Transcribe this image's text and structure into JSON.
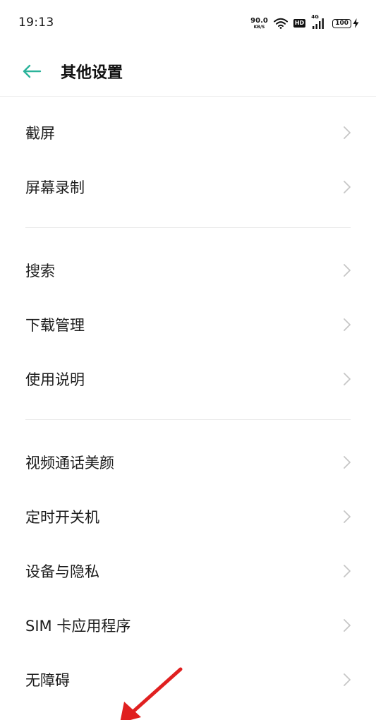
{
  "status_bar": {
    "time": "19:13",
    "net_speed_value": "90.0",
    "net_speed_unit": "KB/S",
    "hd_badge": "HD",
    "network_type": "4G",
    "battery_level": "100",
    "icons": [
      "wifi-icon",
      "signal-icon",
      "battery-icon",
      "charging-icon"
    ]
  },
  "header": {
    "back_icon": "arrow-left-icon",
    "title": "其他设置",
    "accent_color": "#2bb39a"
  },
  "groups": [
    {
      "items": [
        {
          "label": "截屏"
        },
        {
          "label": "屏幕录制"
        }
      ]
    },
    {
      "items": [
        {
          "label": "搜索"
        },
        {
          "label": "下载管理"
        },
        {
          "label": "使用说明"
        }
      ]
    },
    {
      "items": [
        {
          "label": "视频通话美颜"
        },
        {
          "label": "定时开关机"
        },
        {
          "label": "设备与隐私"
        },
        {
          "label": "SIM 卡应用程序"
        },
        {
          "label": "无障碍"
        }
      ]
    }
  ],
  "annotation": {
    "arrow_color": "#e02020",
    "icon": "red-arrow-icon"
  }
}
